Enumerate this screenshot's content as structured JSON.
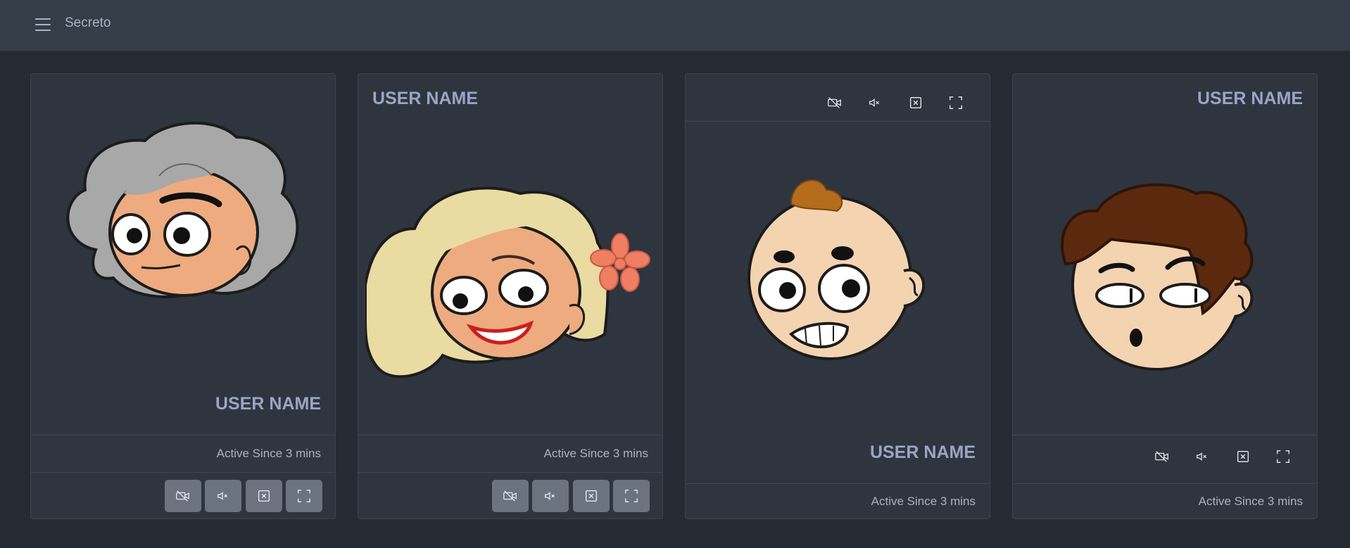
{
  "app": {
    "title": "Secreto",
    "menu_icon": "hamburger-menu-icon"
  },
  "cards": [
    {
      "user_name": "USER NAME",
      "status": "Active Since 3 mins",
      "avatar": "gray-haired-woman-avatar",
      "controls": [
        "video-off-icon",
        "mute-icon",
        "close-box-icon",
        "fullscreen-icon"
      ]
    },
    {
      "user_name": "USER NAME",
      "status": "Active Since 3 mins",
      "avatar": "blonde-woman-flower-avatar",
      "controls": [
        "video-off-icon",
        "mute-icon",
        "close-box-icon",
        "fullscreen-icon"
      ]
    },
    {
      "user_name": "USER NAME",
      "status": "Active Since 3 mins",
      "avatar": "baby-face-avatar",
      "controls": [
        "video-off-icon",
        "mute-icon",
        "close-box-icon",
        "fullscreen-icon"
      ]
    },
    {
      "user_name": "USER NAME",
      "status": "Active Since 3 mins",
      "avatar": "brown-haired-boy-avatar",
      "controls": [
        "video-off-icon",
        "mute-icon",
        "close-box-icon",
        "fullscreen-icon"
      ]
    }
  ],
  "colors": {
    "background": "#252b33",
    "topbar": "#343d48",
    "card": "#2e353f",
    "user_name_text": "#9aa5c6",
    "control_button": "#6b7380"
  }
}
